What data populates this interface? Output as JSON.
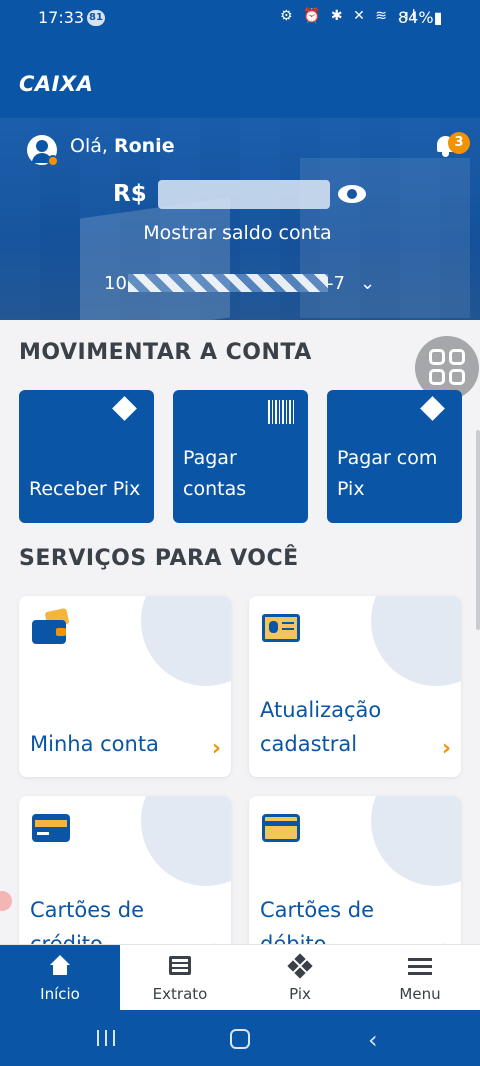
{
  "status_bar": {
    "time": "17:33",
    "notification_count": "81",
    "icons": "⚙ ⏰ ✱ ✕ ≋ .ıl",
    "battery": "84%▮"
  },
  "app": {
    "logo": "CAIXA"
  },
  "hero": {
    "greeting": "Olá,",
    "user_name": "Ronie",
    "notifications": "3",
    "currency": "R$",
    "show_balance": "Mostrar saldo conta",
    "account_prefix": "10",
    "account_suffix": "-7"
  },
  "sections": {
    "move": "MOVIMENTAR A CONTA",
    "services": "SERVIÇOS PARA VOCÊ"
  },
  "quick_actions": [
    {
      "label": "Receber Pix",
      "icon": "pix-receive-icon"
    },
    {
      "label": "Pagar contas",
      "icon": "barcode-icon"
    },
    {
      "label": "Pagar com Pix",
      "icon": "pix-pay-icon"
    }
  ],
  "services": [
    {
      "label": "Minha conta",
      "icon": "wallet-icon"
    },
    {
      "label": "Atualização cadastral",
      "icon": "id-card-icon"
    },
    {
      "label": "Cartões de crédito",
      "icon": "credit-card-icon"
    },
    {
      "label": "Cartões de débito",
      "icon": "debit-card-icon"
    }
  ],
  "bottom_nav": [
    {
      "label": "Início",
      "icon": "home-icon",
      "active": true
    },
    {
      "label": "Extrato",
      "icon": "statement-icon"
    },
    {
      "label": "Pix",
      "icon": "pix-icon"
    },
    {
      "label": "Menu",
      "icon": "menu-icon"
    }
  ],
  "colors": {
    "brand": "#0b55a6",
    "accent": "#f39200"
  }
}
